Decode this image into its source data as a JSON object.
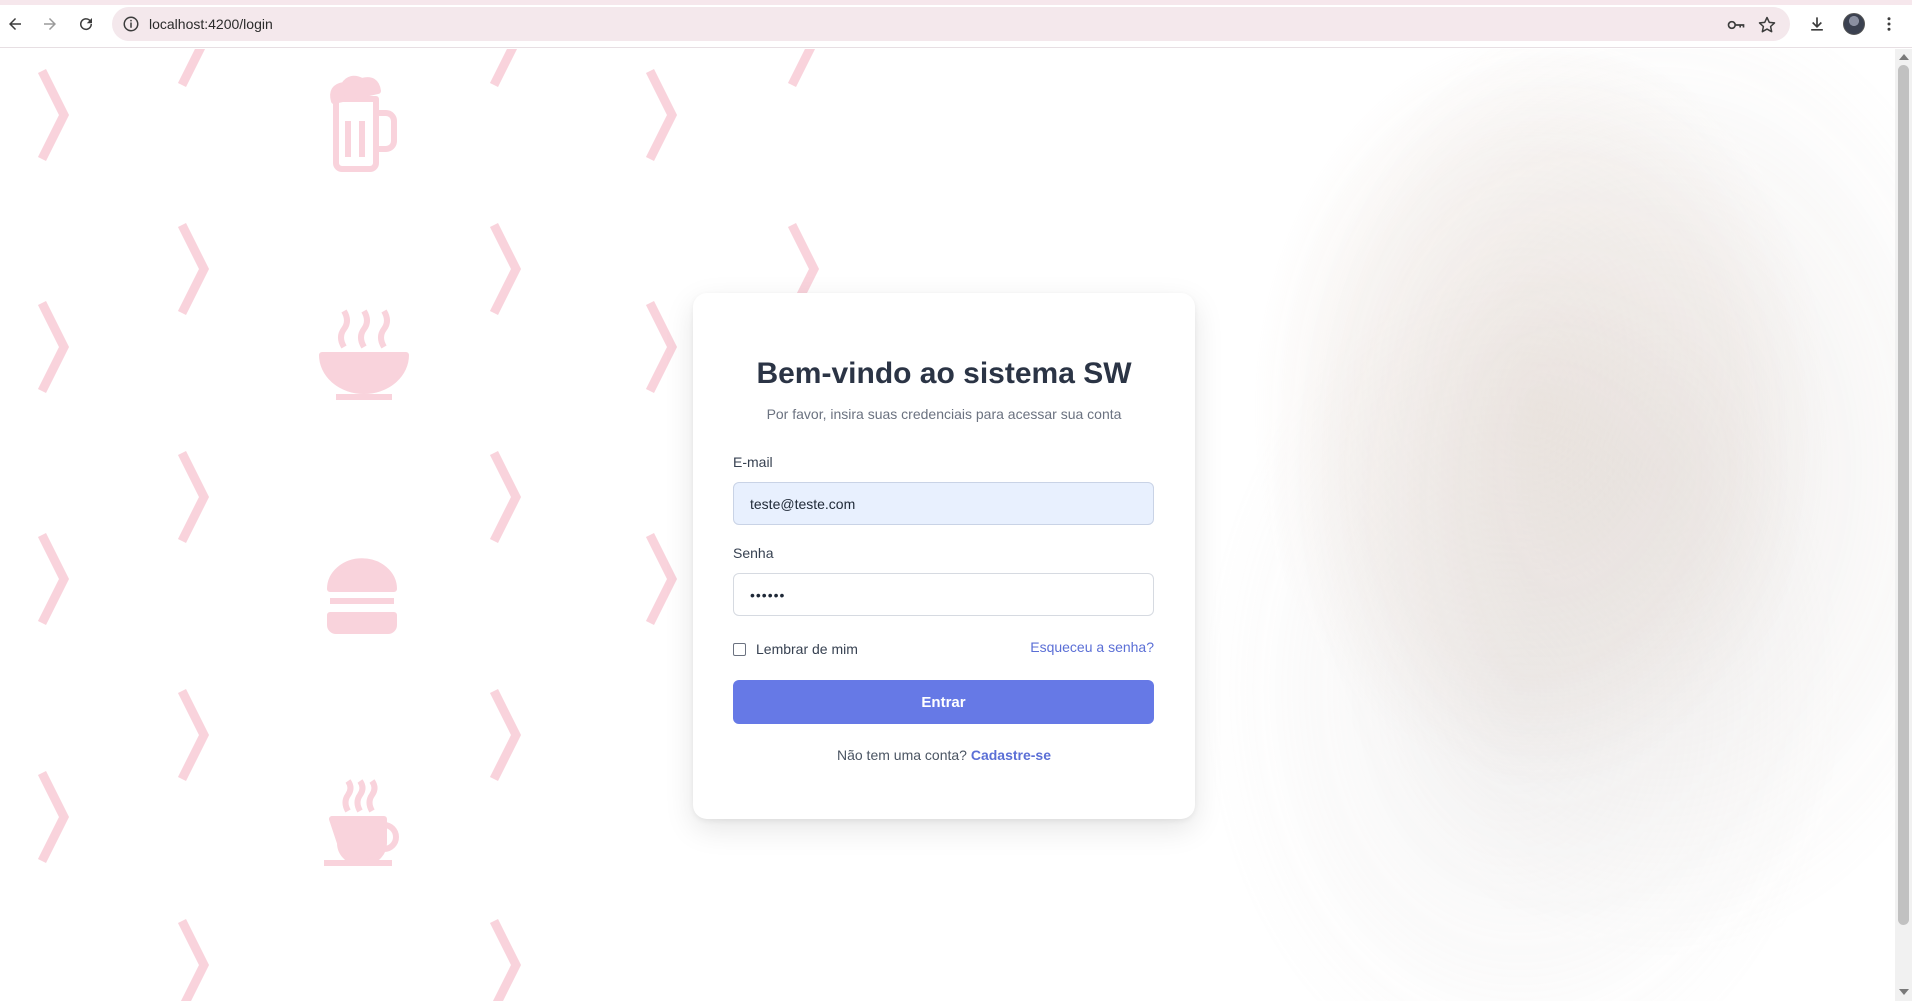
{
  "browser": {
    "url": "localhost:4200/login"
  },
  "login": {
    "title": "Bem-vindo ao sistema SW",
    "subtitle": "Por favor, insira suas credenciais para acessar sua conta",
    "email_label": "E-mail",
    "email_value": "teste@teste.com",
    "password_label": "Senha",
    "password_value": "••••••",
    "remember_label": "Lembrar de mim",
    "remember_checked": false,
    "forgot_link": "Esqueceu a senha?",
    "submit_label": "Entrar",
    "signup_prompt": "Não tem uma conta?",
    "signup_link": "Cadastre-se"
  },
  "colors": {
    "primary": "#6679e6",
    "link": "#5b6fd6",
    "pattern": "#f9d3dc",
    "title": "#2b3445"
  },
  "background_icons": [
    "chevron-icon",
    "beer-mug-icon",
    "soup-bowl-icon",
    "burger-icon",
    "coffee-cup-icon"
  ]
}
